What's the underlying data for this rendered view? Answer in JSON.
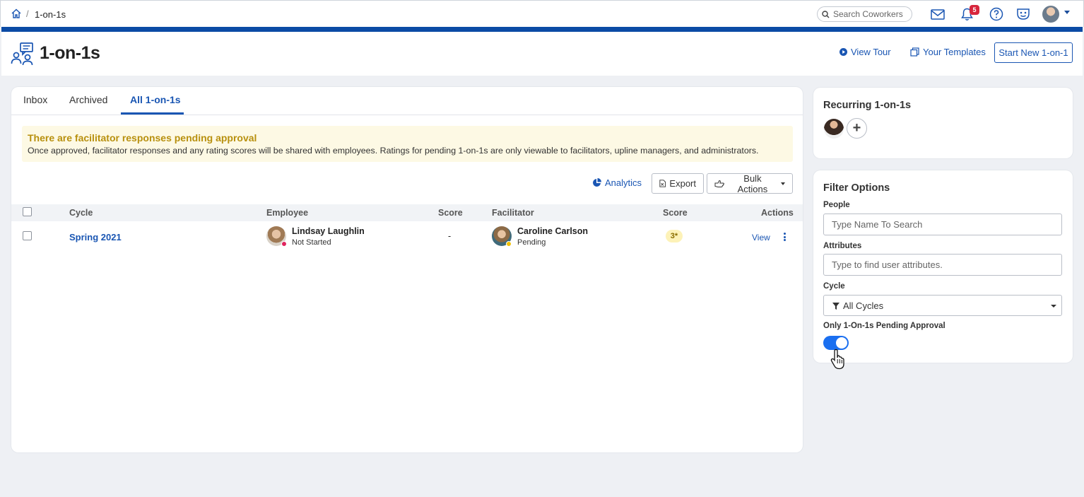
{
  "breadcrumb": {
    "current": "1-on-1s",
    "separator": "/"
  },
  "topbar": {
    "search_placeholder": "Search Coworkers",
    "notifications_count": "5"
  },
  "header": {
    "title": "1-on-1s",
    "view_tour": "View Tour",
    "your_templates": "Your Templates",
    "start_new": "Start New 1-on-1"
  },
  "tabs": [
    {
      "label": "Inbox"
    },
    {
      "label": "Archived"
    },
    {
      "label": "All 1-on-1s",
      "active": true
    }
  ],
  "alert": {
    "title": "There are facilitator responses pending approval",
    "body": "Once approved, facilitator responses and any rating scores will be shared with employees. Ratings for pending 1-on-1s are only viewable to facilitators, upline managers, and administrators."
  },
  "toolbar": {
    "analytics": "Analytics",
    "export": "Export",
    "bulk_actions": "Bulk Actions"
  },
  "table": {
    "columns": [
      "Cycle",
      "Employee",
      "Score",
      "Facilitator",
      "Score",
      "Actions"
    ],
    "rows": [
      {
        "cycle": "Spring 2021",
        "employee_name": "Lindsay Laughlin",
        "employee_status": "Not Started",
        "employee_score": "-",
        "facilitator_name": "Caroline Carlson",
        "facilitator_status": "Pending",
        "facilitator_score": "3*",
        "action": "View"
      }
    ]
  },
  "recurring": {
    "title": "Recurring 1-on-1s",
    "add_label": "+"
  },
  "filters": {
    "title": "Filter Options",
    "people_label": "People",
    "people_placeholder": "Type Name To Search",
    "attributes_label": "Attributes",
    "attributes_placeholder": "Type to find user attributes.",
    "cycle_label": "Cycle",
    "cycle_value": "All Cycles",
    "pending_label": "Only 1-On-1s Pending Approval",
    "pending_enabled": true
  },
  "colors": {
    "brand_blue": "#1a56b3",
    "top_stripe": "#0b4ba5",
    "alert_title": "#b8900e",
    "alert_bg": "#fdf9e4",
    "badge_red": "#d7263d",
    "toggle_on": "#1a6ff0",
    "status_not_started": "#e0245e",
    "status_pending": "#f2c100"
  }
}
